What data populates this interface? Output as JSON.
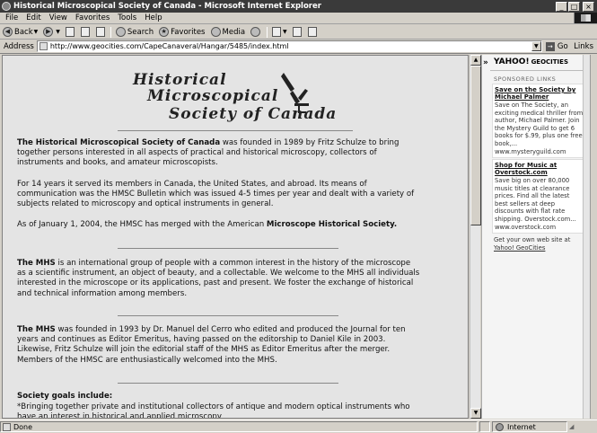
{
  "window": {
    "title": "Historical Microscopical Society of Canada - Microsoft Internet Explorer"
  },
  "menu": {
    "items": [
      "File",
      "Edit",
      "View",
      "Favorites",
      "Tools",
      "Help"
    ]
  },
  "toolbar": {
    "back_label": "Back",
    "search_label": "Search",
    "favorites_label": "Favorites",
    "media_label": "Media"
  },
  "address": {
    "label": "Address",
    "url": "http://www.geocities.com/CapeCanaveral/Hangar/5485/index.html",
    "go_label": "Go",
    "links_label": "Links"
  },
  "page": {
    "logo_lines": [
      "Historical",
      "Microscopical",
      "Society of Canada"
    ],
    "p1_bold": "The Historical Microscopical Society of Canada",
    "p1_rest": " was founded in 1989 by Fritz Schulze to bring together persons interested in all aspects of practical and historical microscopy, collectors of instruments and books, and amateur microscopists.",
    "p2": "For 14 years it served its members in Canada, the United States, and abroad. Its means of communication was the HMSC Bulletin which was issued 4-5 times per year and dealt with a variety of subjects related to microscopy and optical instruments in general.",
    "p3_start": "As of January 1, 2004, the HMSC has merged with the American ",
    "p3_bold": "Microscope Historical Society.",
    "p4_bold": "The MHS",
    "p4_rest": " is an international group of people with a common interest in the history of the microscope as a scientific instrument, an object of beauty, and a collectable. We welcome to the MHS all individuals interested in the microscope or its applications, past and present. We foster the exchange of historical and technical information among members.",
    "p5_bold": "The MHS",
    "p5_rest": " was founded in 1993 by Dr. Manuel del Cerro who edited and produced the Journal for ten years and continues as Editor Emeritus, having passed on the editorship to Daniel Kile in 2003. Likewise, Fritz Schulze will join the editorial staff of the MHS as Editor Emeritus after the merger. Members of the HMSC are enthusiastically welcomed into the MHS.",
    "goals_heading": "Society goals include:",
    "goals_text": "*Bringing together private and institutional collectors of antique and modern optical instruments who have an interest in historical and applied microscopy"
  },
  "sidebar": {
    "chevron": "»",
    "brand_yahoo": "YAHOO!",
    "brand_geo": "GEOCITIES",
    "sponsored": "SPONSORED LINKS",
    "ads": [
      {
        "head": "Save on the Society by Michael Palmer",
        "body": "Save on The Society, an exciting medical thriller from author, Michael Palmer. Join the Mystery Guild to get 6 books for $.99, plus one free book,... www.mysteryguild.com"
      },
      {
        "head": "Shop for Music at Overstock.com",
        "body": "Save big on over 80,000 music titles at clearance prices. Find all the latest best sellers at deep discounts with flat rate shipping. Overstock.com... www.overstock.com"
      }
    ],
    "own_text": "Get your own web site at",
    "own_link": "Yahoo! GeoCities"
  },
  "status": {
    "text": "Done",
    "zone": "Internet"
  }
}
